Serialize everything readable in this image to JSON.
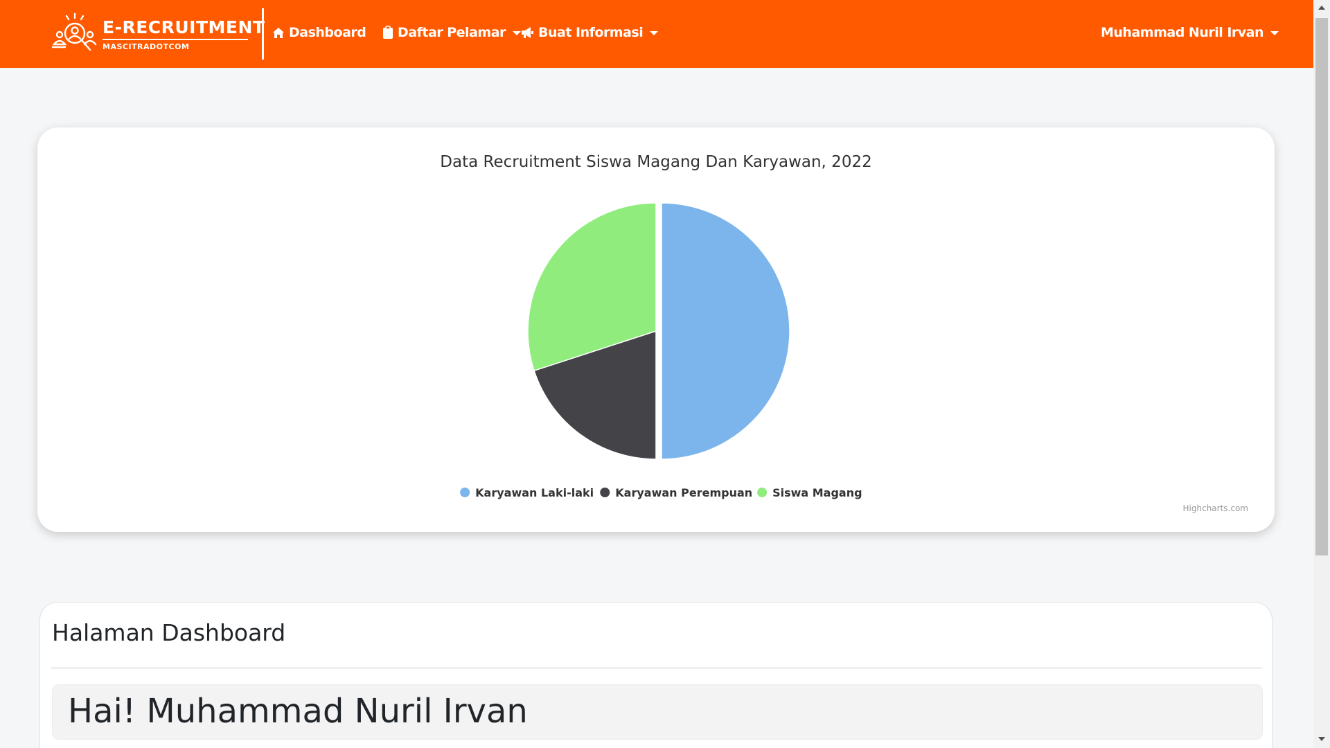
{
  "navbar": {
    "brand_title": "E-RECRUITMENT",
    "brand_subtitle": "MASCITRADOTCOM",
    "items": [
      {
        "label": "Dashboard",
        "icon": "home-icon",
        "dropdown": false
      },
      {
        "label": "Daftar Pelamar",
        "icon": "clipboard-icon",
        "dropdown": true
      },
      {
        "label": "Buat Informasi",
        "icon": "megaphone-icon",
        "dropdown": true
      }
    ],
    "user_label": "Muhammad Nuril Irvan",
    "color": "#ff5a00"
  },
  "chart_data": {
    "type": "pie",
    "title": "Data Recruitment Siswa Magang Dan Karyawan, 2022",
    "categories": [
      "Karyawan Laki-laki",
      "Karyawan Perempuan",
      "Siswa Magang"
    ],
    "values": [
      50,
      20,
      30
    ],
    "colors": [
      "#7cb5ec",
      "#434348",
      "#90ed7d"
    ],
    "sliced": [
      true,
      false,
      false
    ],
    "legend_position": "bottom-center",
    "credits": "Highcharts.com"
  },
  "dashboard": {
    "title": "Halaman Dashboard",
    "greeting": "Hai! Muhammad Nuril Irvan"
  }
}
